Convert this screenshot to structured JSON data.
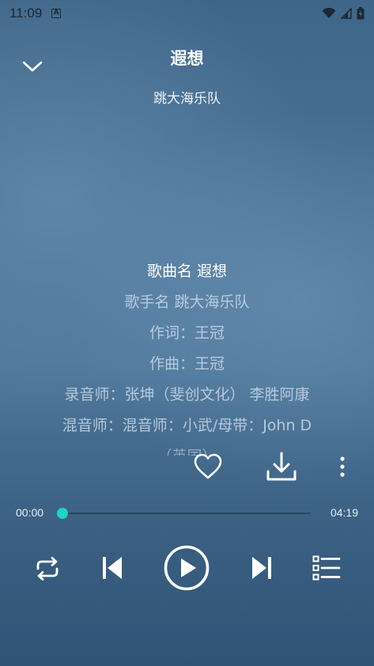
{
  "status_bar": {
    "time": "11:09",
    "a_icon_label": "A",
    "icons": [
      "wifi-icon",
      "signal-icon",
      "battery-icon"
    ]
  },
  "header": {
    "title": "遐想",
    "artist": "跳大海乐队",
    "collapse_icon": "chevron-down-icon"
  },
  "lyrics": {
    "lines": [
      "歌曲名 遐想",
      "歌手名 跳大海乐队",
      "作词：王冠",
      "作曲：王冠",
      "录音师：张坤（斐创文化） 李胜阿康",
      "混音师：混音师：小武/母带：John D",
      "（英国）"
    ],
    "active_index": 0
  },
  "actions": {
    "icons": [
      "heart-icon",
      "download-icon",
      "more-vertical-icon"
    ]
  },
  "playback": {
    "current_time": "00:00",
    "total_time": "04:19",
    "progress": 0,
    "accent_color": "#1fd3c5"
  },
  "controls": {
    "icons": [
      "repeat-icon",
      "previous-icon",
      "play-icon",
      "next-icon",
      "playlist-icon"
    ]
  }
}
